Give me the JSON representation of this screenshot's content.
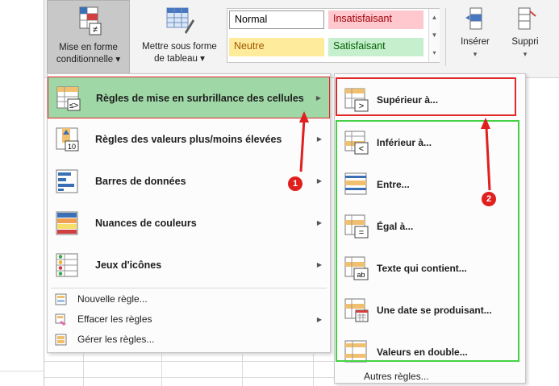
{
  "ribbon": {
    "conditional_formatting": {
      "line1": "Mise en forme",
      "line2": "conditionnelle ▾"
    },
    "format_as_table": {
      "line1": "Mettre sous forme",
      "line2": "de tableau ▾"
    },
    "styles": {
      "normal": "Normal",
      "bad": "Insatisfaisant",
      "neutral": "Neutre",
      "good": "Satisfaisant"
    },
    "insert": {
      "label": "Insérer",
      "caret": "▾"
    },
    "delete": {
      "label": "Suppri",
      "caret": "▾"
    }
  },
  "menu": {
    "items": [
      {
        "label": "Règles de mise en surbrillance des cellules",
        "underline_char": "b",
        "icon": "highlight-rules-icon",
        "arrow": "▶"
      },
      {
        "label": "Règles des valeurs plus/moins élevées",
        "icon": "top-bottom-rules-icon",
        "arrow": "▶"
      },
      {
        "label": "Barres de données",
        "icon": "data-bars-icon",
        "arrow": "▶"
      },
      {
        "label": "Nuances de couleurs",
        "icon": "color-scales-icon",
        "arrow": "▶"
      },
      {
        "label": "Jeux d'icônes",
        "icon": "icon-sets-icon",
        "arrow": "▶"
      }
    ],
    "small_items": [
      {
        "label": "Nouvelle règle...",
        "icon": "new-rule-icon"
      },
      {
        "label": "Effacer les règles",
        "icon": "clear-rules-icon",
        "arrow": "▶"
      },
      {
        "label": "Gérer les règles...",
        "icon": "manage-rules-icon"
      }
    ]
  },
  "submenu": {
    "items": [
      {
        "label": "Supérieur à...",
        "icon": "greater-than-icon",
        "icon_text": ">"
      },
      {
        "label": "Inférieur à...",
        "icon": "less-than-icon",
        "icon_text": "<"
      },
      {
        "label": "Entre...",
        "icon": "between-icon",
        "icon_text": ""
      },
      {
        "label": "Égal à...",
        "icon": "equal-to-icon",
        "icon_text": "="
      },
      {
        "label": "Texte qui contient...",
        "icon": "text-contains-icon",
        "icon_text": "ab"
      },
      {
        "label": "Une date se produisant...",
        "icon": "date-occurring-icon",
        "icon_text": ""
      },
      {
        "label": "Valeurs en double...",
        "icon": "duplicate-values-icon",
        "icon_text": ""
      }
    ],
    "more_rules": "Autres règles..."
  },
  "annotations": {
    "badge1": "1",
    "badge2": "2"
  },
  "colors": {
    "highlight": "#9fd7a6",
    "red_box": "#e02a2a",
    "green_box": "#44d244",
    "badge": "#e01f1f"
  }
}
